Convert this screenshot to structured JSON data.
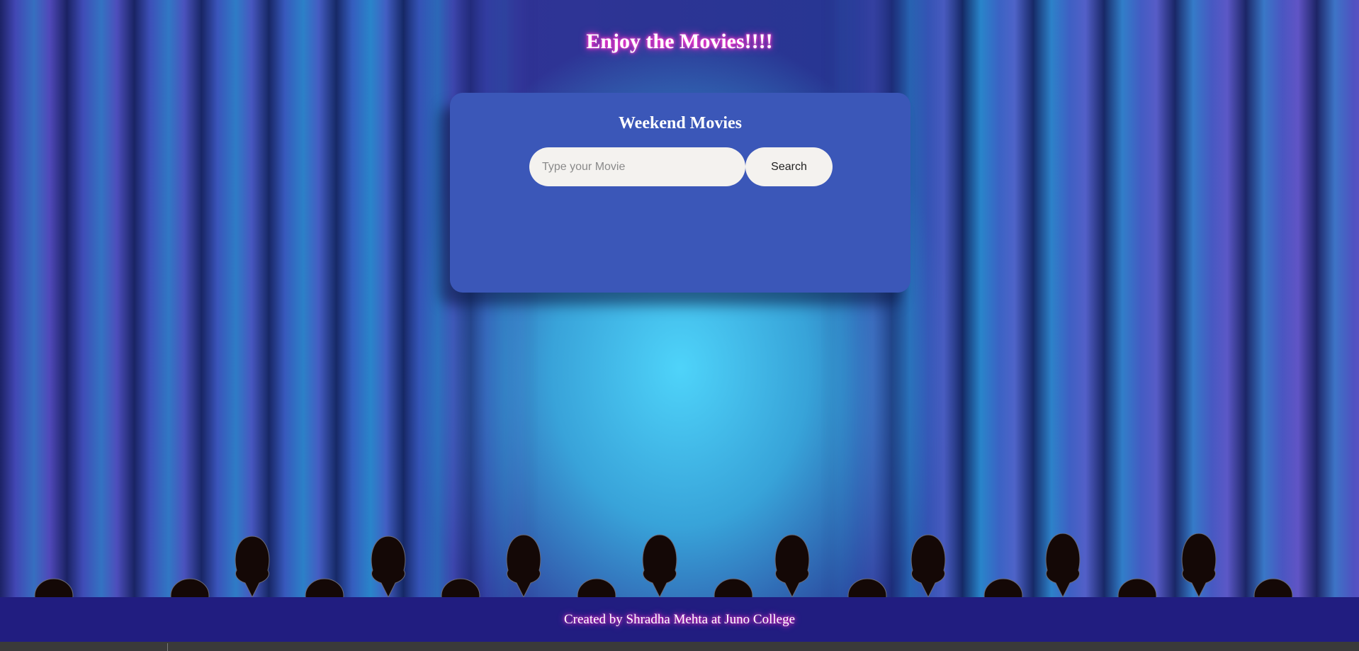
{
  "header": {
    "title": "Enjoy the Movies!!!!"
  },
  "card": {
    "title": "Weekend Movies",
    "search": {
      "placeholder": "Type your Movie",
      "value": "",
      "button_label": "Search"
    }
  },
  "footer": {
    "text": "Created by Shradha Mehta at Juno College"
  },
  "colors": {
    "card": "#3b57b8",
    "footer": "#211d80",
    "title_glow": "#ff2fd0",
    "silhouette": "#140806"
  },
  "icons": {
    "audience": "audience-silhouettes"
  }
}
